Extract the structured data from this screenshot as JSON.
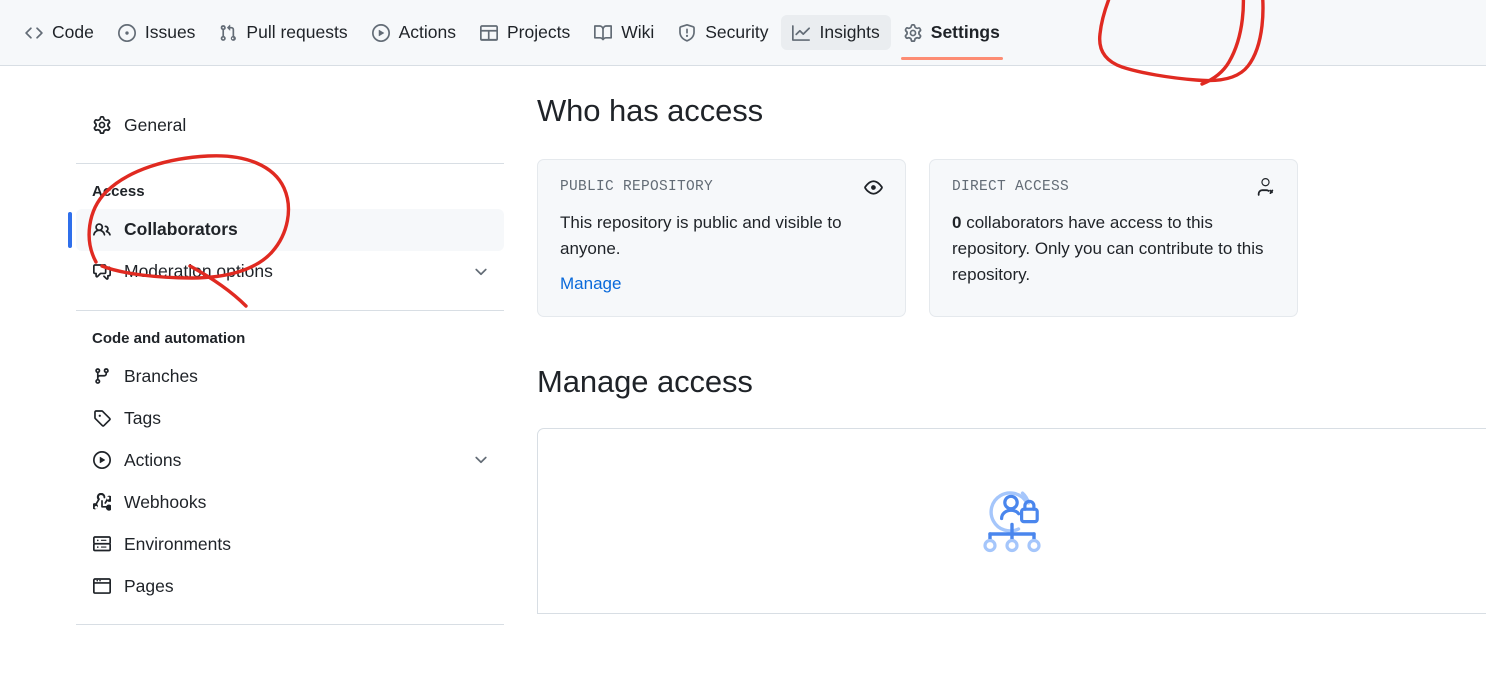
{
  "repo_nav": {
    "tabs": [
      {
        "label": "Code",
        "icon": "code-icon",
        "state": "normal"
      },
      {
        "label": "Issues",
        "icon": "issue-opened-icon",
        "state": "normal"
      },
      {
        "label": "Pull requests",
        "icon": "git-pull-request-icon",
        "state": "normal"
      },
      {
        "label": "Actions",
        "icon": "play-icon",
        "state": "normal"
      },
      {
        "label": "Projects",
        "icon": "table-icon",
        "state": "normal"
      },
      {
        "label": "Wiki",
        "icon": "book-icon",
        "state": "normal"
      },
      {
        "label": "Security",
        "icon": "shield-icon",
        "state": "normal"
      },
      {
        "label": "Insights",
        "icon": "graph-icon",
        "state": "hovered"
      },
      {
        "label": "Settings",
        "icon": "gear-icon",
        "state": "selected"
      }
    ],
    "active_tab": "Settings",
    "active_underline_color": "#fd8c73"
  },
  "sidebar": {
    "top_items": [
      {
        "label": "General",
        "icon": "gear-icon",
        "expandable": false,
        "active": false
      }
    ],
    "access_group": {
      "title": "Access",
      "items": [
        {
          "label": "Collaborators",
          "icon": "people-icon",
          "expandable": false,
          "active": true
        },
        {
          "label": "Moderation options",
          "icon": "comment-discussion-icon",
          "expandable": true,
          "active": false
        }
      ]
    },
    "code_group": {
      "title": "Code and automation",
      "items": [
        {
          "label": "Branches",
          "icon": "git-branch-icon",
          "expandable": false,
          "active": false
        },
        {
          "label": "Tags",
          "icon": "tag-icon",
          "expandable": false,
          "active": false
        },
        {
          "label": "Actions",
          "icon": "play-icon",
          "expandable": true,
          "active": false
        },
        {
          "label": "Webhooks",
          "icon": "webhook-icon",
          "expandable": false,
          "active": false
        },
        {
          "label": "Environments",
          "icon": "server-icon",
          "expandable": false,
          "active": false
        },
        {
          "label": "Pages",
          "icon": "browser-icon",
          "expandable": false,
          "active": false
        }
      ]
    },
    "active_indicator_color": "#2f6feb"
  },
  "main": {
    "who_has_access_heading": "Who has access",
    "cards": [
      {
        "kicker": "PUBLIC REPOSITORY",
        "icon": "eye-icon",
        "body_text": "This repository is public and visible to anyone.",
        "link_label": "Manage",
        "link_color": "#0969da"
      },
      {
        "kicker": "DIRECT ACCESS",
        "icon": "person-icon",
        "count": "0",
        "body_text": " collaborators have access to this repository. Only you can contribute to this repository."
      }
    ],
    "manage_access_heading": "Manage access",
    "empty_state_illustration": "locked-user-hierarchy-illustration"
  },
  "annotations": {
    "stroke_color": "#e02a21",
    "marks": [
      {
        "name": "settings-tab-circle",
        "target": "Settings"
      },
      {
        "name": "collaborators-circle",
        "target": "Collaborators"
      }
    ]
  }
}
